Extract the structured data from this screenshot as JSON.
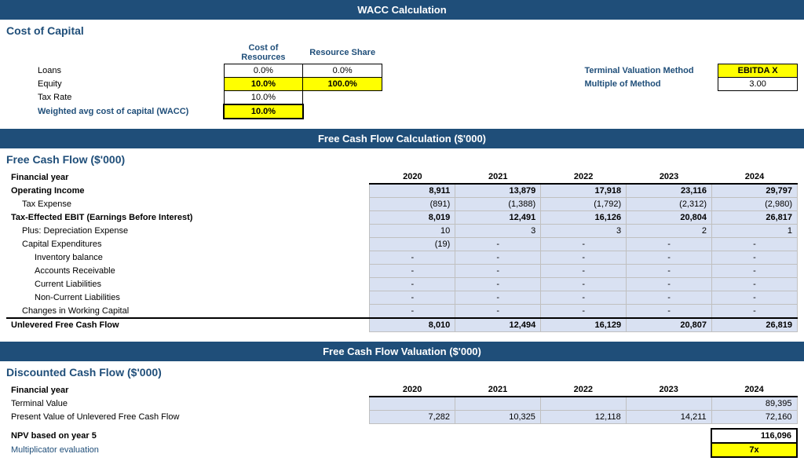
{
  "page_title": "WACC Calculation",
  "sections": {
    "wacc": {
      "header": "WACC Calculation",
      "sub_header": "Cost of Capital",
      "col_header1": "Cost of Resources",
      "col_header2": "Resource Share",
      "rows": [
        {
          "label": "Loans",
          "cost": "0.0%",
          "share": "0.0%"
        },
        {
          "label": "Equity",
          "cost": "10.0%",
          "share": "100.0%"
        },
        {
          "label": "Tax Rate",
          "cost": "10.0%",
          "share": ""
        },
        {
          "label": "Weighted avg cost of capital (WACC)",
          "cost": "10.0%",
          "share": ""
        }
      ],
      "terminal_label": "Terminal Valuation Method",
      "multiple_label": "Multiple of Method",
      "terminal_value": "EBITDA X",
      "multiple_value": "3.00"
    },
    "fcf": {
      "header": "Free Cash Flow Calculation ($'000)",
      "sub_header": "Free Cash Flow ($'000)",
      "years_label": "Financial year",
      "years": [
        "2020",
        "2021",
        "2022",
        "2023",
        "2024"
      ],
      "rows": [
        {
          "label": "Operating Income",
          "indent": 0,
          "bold": true,
          "values": [
            "8,911",
            "13,879",
            "17,918",
            "23,116",
            "29,797"
          ]
        },
        {
          "label": "Tax Expense",
          "indent": 1,
          "bold": false,
          "values": [
            "(891)",
            "(1,388)",
            "(1,792)",
            "(2,312)",
            "(2,980)"
          ]
        },
        {
          "label": "Tax-Effected EBIT (Earnings Before Interest)",
          "indent": 0,
          "bold": true,
          "values": [
            "8,019",
            "12,491",
            "16,126",
            "20,804",
            "26,817"
          ]
        },
        {
          "label": "Plus: Depreciation Expense",
          "indent": 1,
          "bold": false,
          "values": [
            "10",
            "3",
            "3",
            "2",
            "1"
          ]
        },
        {
          "label": "Capital Expenditures",
          "indent": 1,
          "bold": false,
          "values": [
            "(19)",
            "-",
            "-",
            "-",
            "-"
          ]
        },
        {
          "label": "Inventory balance",
          "indent": 2,
          "bold": false,
          "values": [
            "-",
            "-",
            "-",
            "-",
            "-"
          ]
        },
        {
          "label": "Accounts Receivable",
          "indent": 2,
          "bold": false,
          "values": [
            "-",
            "-",
            "-",
            "-",
            "-"
          ]
        },
        {
          "label": "Current Liabilities",
          "indent": 2,
          "bold": false,
          "values": [
            "-",
            "-",
            "-",
            "-",
            "-"
          ]
        },
        {
          "label": "Non-Current Liabilities",
          "indent": 2,
          "bold": false,
          "values": [
            "-",
            "-",
            "-",
            "-",
            "-"
          ]
        },
        {
          "label": "Changes in Working Capital",
          "indent": 1,
          "bold": false,
          "values": [
            "-",
            "-",
            "-",
            "-",
            "-"
          ]
        },
        {
          "label": "Unlevered Free Cash Flow",
          "indent": 0,
          "bold": true,
          "total": true,
          "values": [
            "8,010",
            "12,494",
            "16,129",
            "20,807",
            "26,819"
          ]
        }
      ]
    },
    "valuation": {
      "header": "Free Cash Flow Valuation ($'000)",
      "sub_header": "Discounted Cash Flow ($'000)",
      "years_label": "Financial year",
      "years": [
        "2020",
        "2021",
        "2022",
        "2023",
        "2024"
      ],
      "rows": [
        {
          "label": "Terminal Value",
          "indent": 0,
          "bold": false,
          "values": [
            "",
            "",
            "",
            "",
            "89,395"
          ]
        },
        {
          "label": "Present Value of Unlevered Free Cash Flow",
          "indent": 0,
          "bold": false,
          "values": [
            "7,282",
            "10,325",
            "12,118",
            "14,211",
            "72,160"
          ]
        }
      ],
      "npv_label": "NPV based on year 5",
      "npv_value": "116,096",
      "mult_label": "Multiplicator evaluation",
      "mult_value": "7x"
    }
  }
}
